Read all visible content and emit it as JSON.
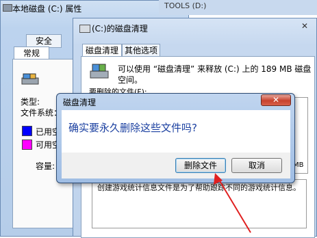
{
  "back_window": {
    "title": "本地磁盘 (C:) 属性",
    "tabs": [
      "安全",
      "常规"
    ],
    "type_label": "类型:",
    "fs_label": "文件系统：",
    "used_label": "已用空",
    "free_label": "可用空",
    "capacity_label": "容量:",
    "used_color": "#0000ff",
    "free_color": "#ff00ff"
  },
  "behind_title": "TOOLS (D:)",
  "cleanup_window": {
    "title": "(C:)的磁盘清理",
    "close_glyph": "✕",
    "tabs": [
      "磁盘清理",
      "其他选项"
    ],
    "info_text": "可以使用 “磁盘清理” 来释放  (C:) 上的 189 MB 磁盘空间。",
    "files_label": "要删除的文件(F):",
    "size_unit": "MB",
    "description": "创建游戏统计信息文件是为了帮助跟踪不同的游戏统计信息。"
  },
  "dialog": {
    "title": "磁盘清理",
    "close_glyph": "✕",
    "question": "确实要永久删除这些文件吗?",
    "delete_label": "删除文件",
    "cancel_label": "取消"
  },
  "icons": [
    "drive-icon",
    "disk-cleanup-icon",
    "close-icon",
    "red-arrow"
  ]
}
